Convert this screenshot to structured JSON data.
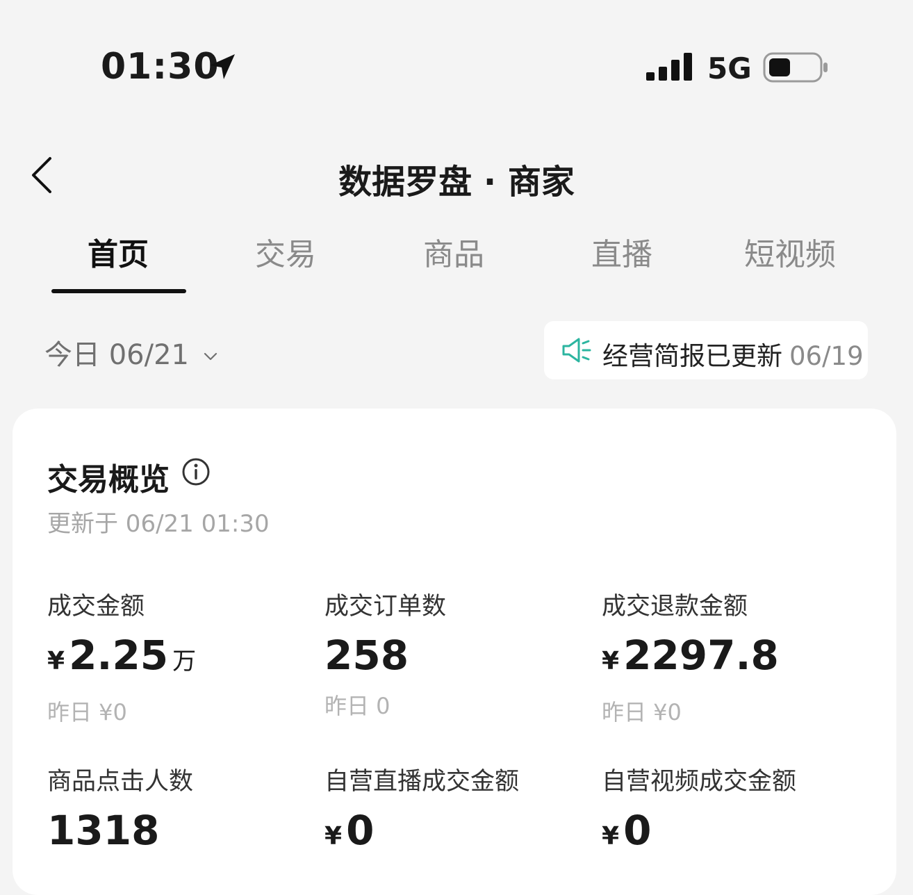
{
  "status_bar": {
    "time": "01:30",
    "network": "5G"
  },
  "nav": {
    "title": "数据罗盘 · 商家"
  },
  "tabs": [
    {
      "label": "首页",
      "active": true
    },
    {
      "label": "交易",
      "active": false
    },
    {
      "label": "商品",
      "active": false
    },
    {
      "label": "直播",
      "active": false
    },
    {
      "label": "短视频",
      "active": false
    }
  ],
  "date_filter": {
    "label": "今日 06/21"
  },
  "report_banner": {
    "text": "经营简报已更新",
    "date": "06/19"
  },
  "overview": {
    "title": "交易概览",
    "updated": "更新于 06/21 01:30",
    "metrics": [
      {
        "label": "成交金额",
        "currency": "¥",
        "value": "2.25",
        "unit": "万",
        "prev": "昨日 ¥0"
      },
      {
        "label": "成交订单数",
        "currency": "",
        "value": "258",
        "unit": "",
        "prev": "昨日 0"
      },
      {
        "label": "成交退款金额",
        "currency": "¥",
        "value": "2297.8",
        "unit": "",
        "prev": "昨日 ¥0"
      },
      {
        "label": "商品点击人数",
        "currency": "",
        "value": "1318",
        "unit": "",
        "prev": ""
      },
      {
        "label": "自营直播成交金额",
        "currency": "¥",
        "value": "0",
        "unit": "",
        "prev": ""
      },
      {
        "label": "自营视频成交金额",
        "currency": "¥",
        "value": "0",
        "unit": "",
        "prev": ""
      }
    ]
  },
  "colors": {
    "accent": "#2cb5a0",
    "background": "#f4f4f4",
    "card": "#ffffff"
  }
}
